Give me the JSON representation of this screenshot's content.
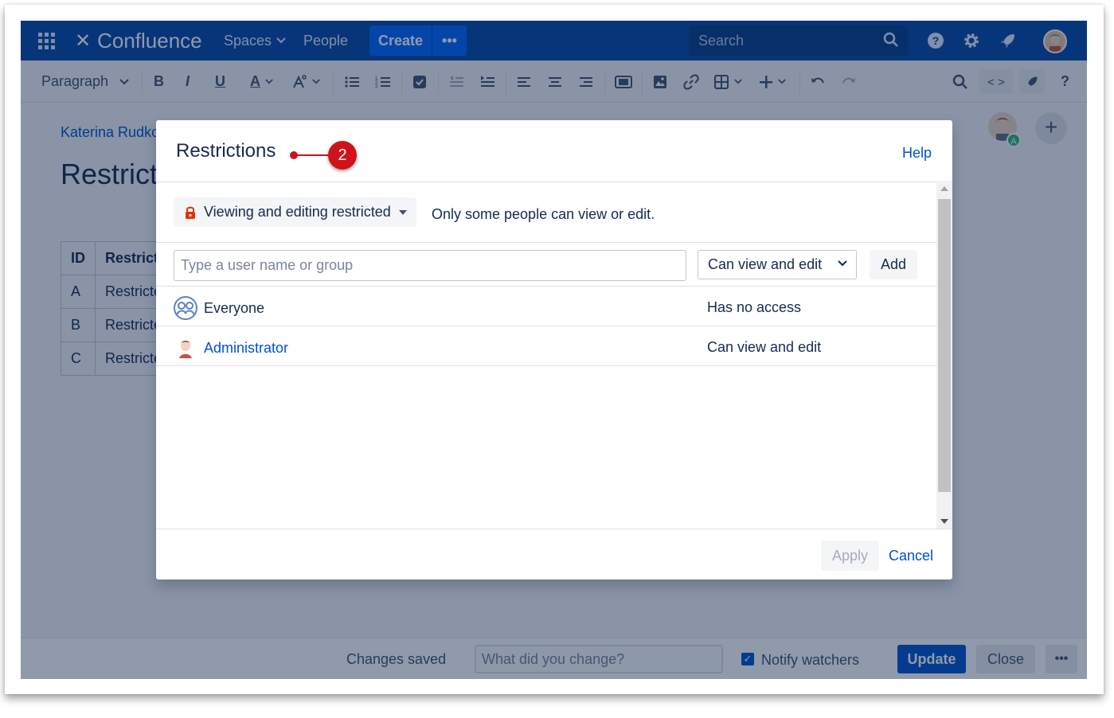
{
  "nav": {
    "logo_text": "Confluence",
    "spaces_label": "Spaces",
    "people_label": "People",
    "create_label": "Create",
    "more_label": "•••",
    "search_placeholder": "Search",
    "help_glyph": "?"
  },
  "toolbar": {
    "paragraph_label": "Paragraph",
    "bold": "B",
    "italic": "I",
    "underline": "U",
    "text_color": "A",
    "source_label": "< >",
    "help": "?"
  },
  "page": {
    "author": "Katerina Rudkov",
    "title": "Restricted",
    "table_headers": [
      "ID",
      "Restricted"
    ],
    "table_rows": [
      [
        "A",
        "Restricted"
      ],
      [
        "B",
        "Restricted"
      ],
      [
        "C",
        "Restricted"
      ]
    ],
    "collaborator_badge": "A"
  },
  "dialog": {
    "title": "Restrictions",
    "help_label": "Help",
    "marker": "2",
    "restriction_mode": "Viewing and editing restricted",
    "restriction_description": "Only some people can view or edit.",
    "user_input_placeholder": "Type a user name or group",
    "permission_selected": "Can view and edit",
    "add_label": "Add",
    "rows": [
      {
        "name": "Everyone",
        "access": "Has no access"
      },
      {
        "name": "Administrator",
        "access": "Can view and edit"
      }
    ],
    "apply_label": "Apply",
    "cancel_label": "Cancel"
  },
  "footer": {
    "saved_text": "Changes saved",
    "change_placeholder": "What did you change?",
    "notify_label": "Notify watchers",
    "update_label": "Update",
    "close_label": "Close",
    "more_label": "•••"
  },
  "colors": {
    "nav_bg": "#0747a6",
    "primary": "#0052cc",
    "marker": "#d0121b",
    "lock": "#de350b"
  }
}
